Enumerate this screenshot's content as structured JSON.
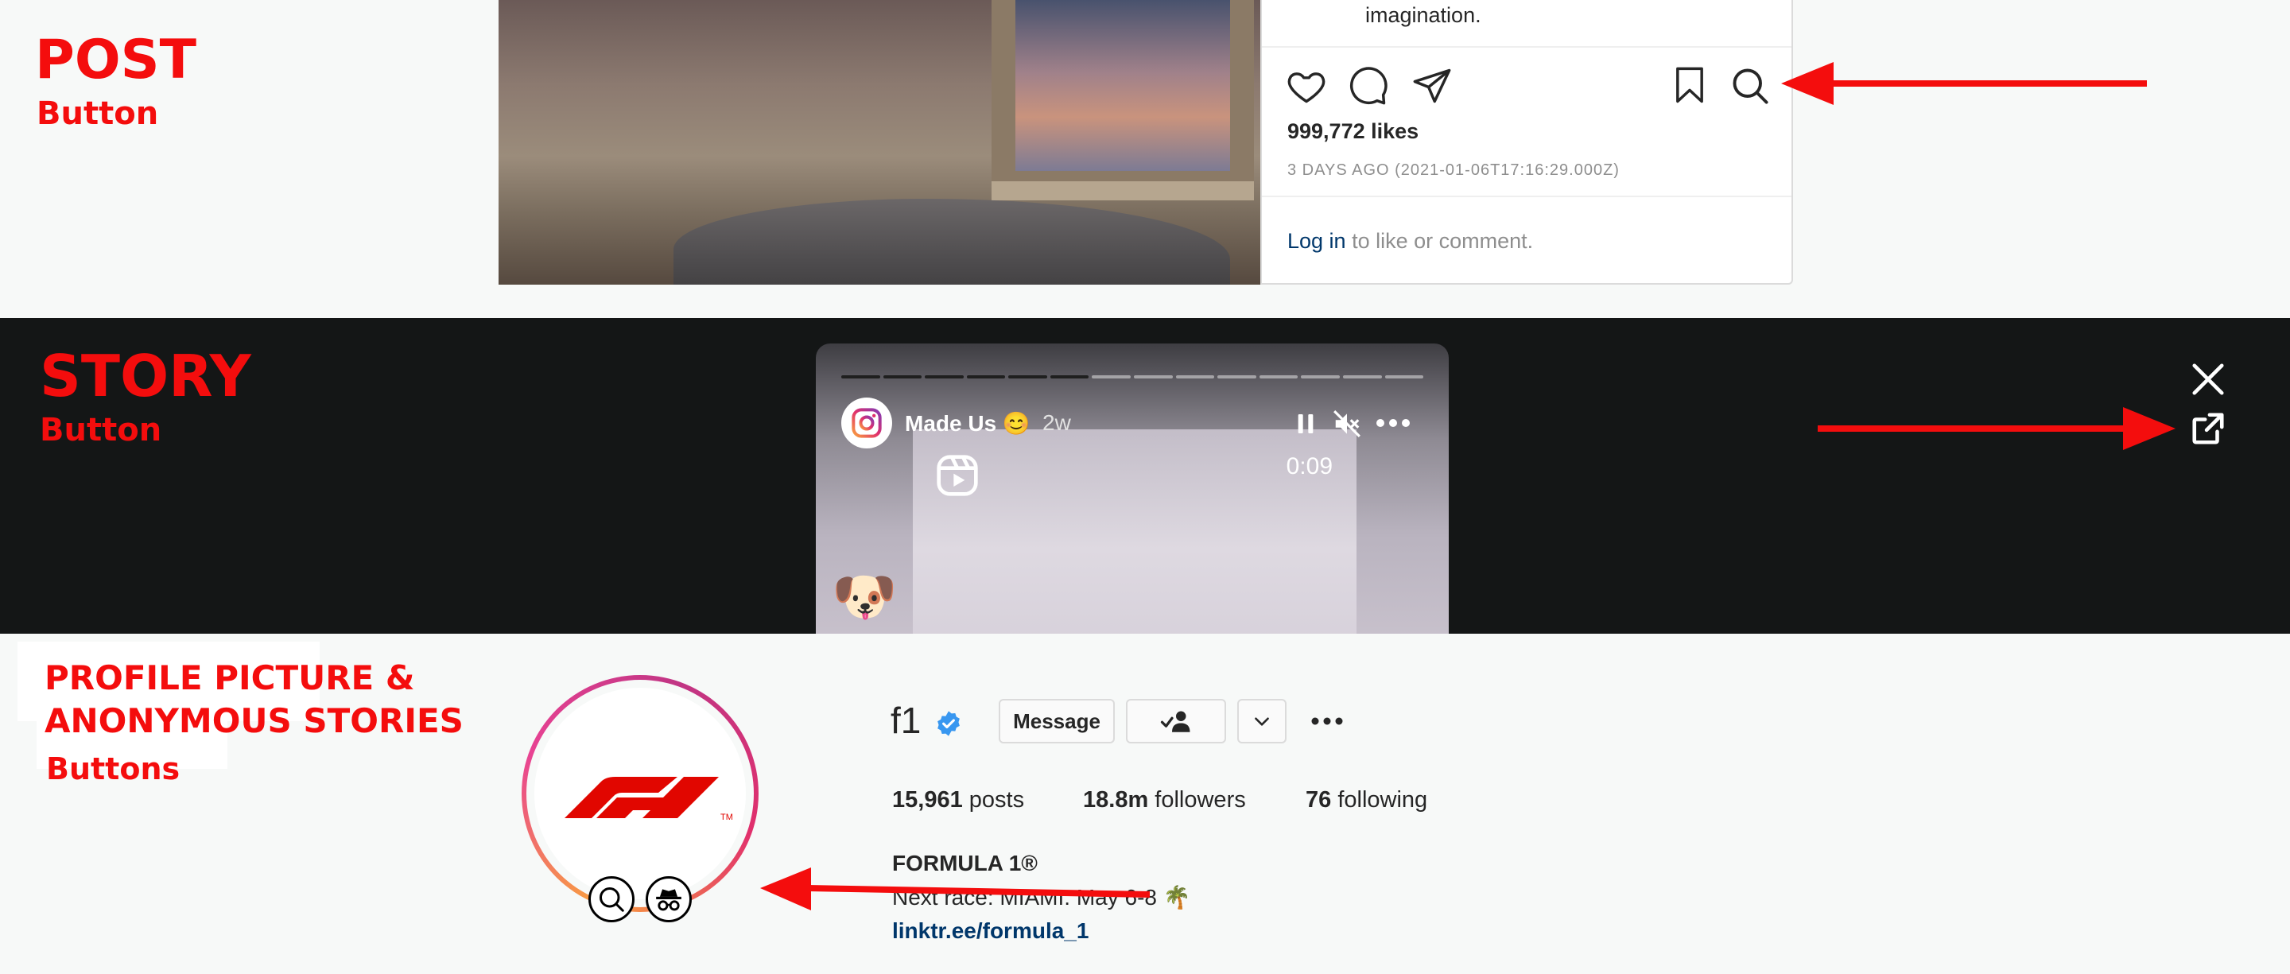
{
  "post": {
    "annotation_title": "POST",
    "annotation_sub": "Button",
    "caption": "imagination.",
    "likes": "999,772 likes",
    "timestamp": "3 DAYS AGO (2021-01-06T17:16:29.000Z)",
    "login_link": "Log in",
    "login_rest": " to like or comment.",
    "icons": [
      "heart-icon",
      "comment-icon",
      "share-icon",
      "bookmark-icon",
      "search-icon"
    ]
  },
  "story": {
    "annotation_title": "STORY",
    "annotation_sub": "Button",
    "username": "Made Us 😊",
    "age": "2w",
    "duration": "0:09",
    "emoji": "🐶",
    "progress_done": 6,
    "progress_total": 14,
    "icons": [
      "instagram-icon",
      "reels-icon",
      "pause-icon",
      "mute-icon",
      "more-icon",
      "close-icon",
      "external-link-icon"
    ]
  },
  "profile": {
    "annotation_line1": "PROFILE PICTURE &",
    "annotation_line2": "ANONYMOUS STORIES",
    "annotation_sub": "Buttons",
    "username": "f1",
    "message_label": "Message",
    "stats": {
      "posts_value": "15,961",
      "posts_label": " posts",
      "followers_value": "18.8m",
      "followers_label": " followers",
      "following_value": "76",
      "following_label": " following"
    },
    "bio_name": "FORMULA 1®",
    "bio_text": "Next race: MIAMI: May 6-8 🌴",
    "bio_link": "linktr.ee/formula_1",
    "icons": [
      "verified-icon",
      "following-icon",
      "chevron-down-icon",
      "more-icon",
      "search-icon",
      "incognito-icon"
    ]
  },
  "colors": {
    "annotation_red": "#f40d0d",
    "link_blue": "#00376b",
    "story_bg": "#141616",
    "verified_blue": "#3897f0"
  }
}
